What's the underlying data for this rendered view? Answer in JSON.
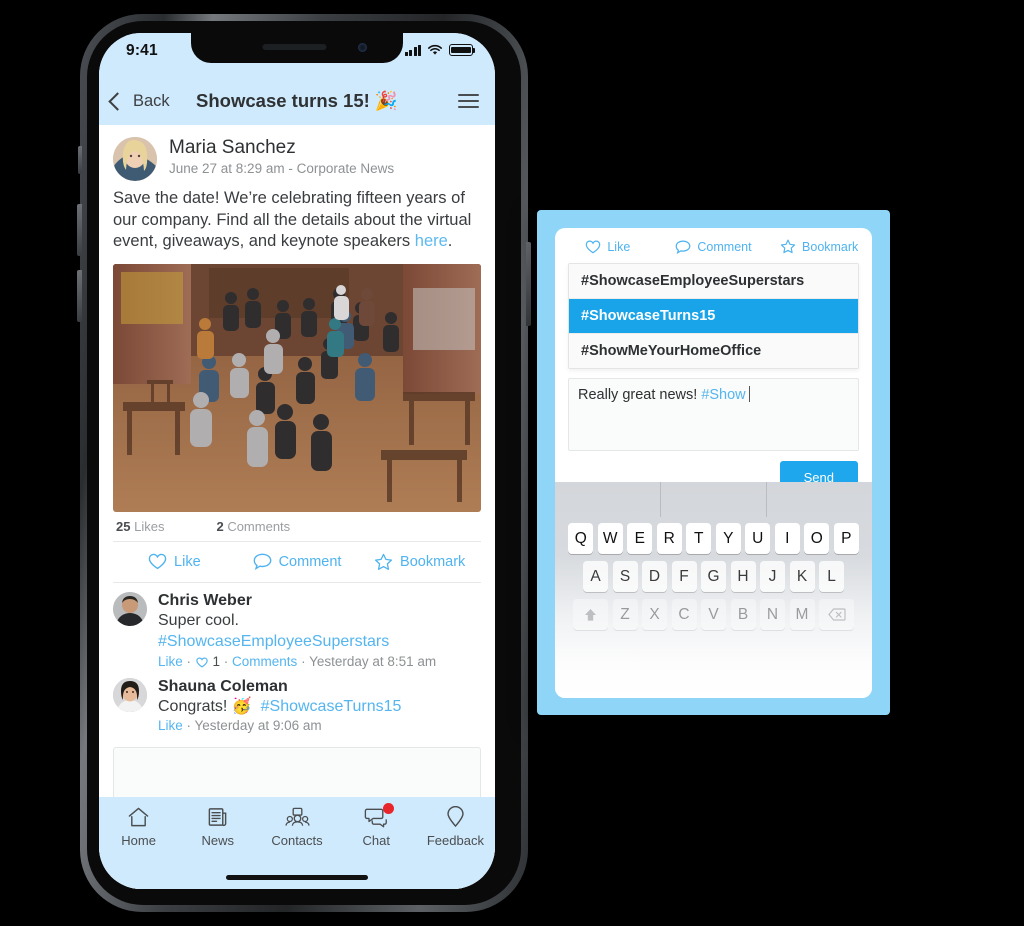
{
  "phone": {
    "status_bar": {
      "time": "9:41",
      "signal_icon": "cellular-signal-icon",
      "wifi_icon": "wifi-icon",
      "battery_icon": "battery-icon"
    },
    "nav": {
      "back_label": "Back",
      "title": "Showcase turns 15! 🎉",
      "menu_icon": "hamburger-menu-icon",
      "back_icon": "chevron-left-icon"
    },
    "post": {
      "author": "Maria Sanchez",
      "meta": "June 27 at 8:29 am - Corporate News",
      "body_part1": "Save the date! We’re celebrating fifteen years of our company. Find all the details about the virtual event, giveaways, and keynote speakers ",
      "body_link": "here",
      "body_part2": ".",
      "likes_count": "25",
      "likes_label": "Likes",
      "comments_count": "2",
      "comments_label": "Comments",
      "photo_alt": "group-photo-of-employees"
    },
    "actions": [
      {
        "label": "Like",
        "icon": "heart-outline-icon"
      },
      {
        "label": "Comment",
        "icon": "speech-bubble-icon"
      },
      {
        "label": "Bookmark",
        "icon": "star-outline-icon"
      }
    ],
    "comments": [
      {
        "name": "Chris Weber",
        "text": "Super cool.",
        "hashtag": "#ShowcaseEmployeeSuperstars",
        "like_label": "Like",
        "like_count": "1",
        "comments_label": "Comments",
        "time": "Yesterday at 8:51 am"
      },
      {
        "name": "Shauna Coleman",
        "text": "Congrats! 🥳",
        "hashtag": "#ShowcaseTurns15",
        "like_label": "Like",
        "time": "Yesterday at 9:06 am"
      }
    ],
    "reply_placeholder": "",
    "tabs": [
      {
        "label": "Home",
        "icon": "home-icon",
        "badge": false
      },
      {
        "label": "News",
        "icon": "newspaper-icon",
        "badge": false
      },
      {
        "label": "Contacts",
        "icon": "contacts-group-icon",
        "badge": false
      },
      {
        "label": "Chat",
        "icon": "chat-bubbles-icon",
        "badge": true
      },
      {
        "label": "Feedback",
        "icon": "location-pin-icon",
        "badge": false
      }
    ]
  },
  "panel": {
    "actions": [
      {
        "label": "Like",
        "icon": "heart-outline-icon"
      },
      {
        "label": "Comment",
        "icon": "speech-bubble-icon"
      },
      {
        "label": "Bookmark",
        "icon": "star-outline-icon"
      }
    ],
    "suggestions": [
      {
        "label": "#ShowcaseEmployeeSuperstars",
        "selected": false
      },
      {
        "label": "#ShowcaseTurns15",
        "selected": true
      },
      {
        "label": "#ShowMeYourHomeOffice",
        "selected": false
      }
    ],
    "compose": {
      "text": "Really great news!",
      "tag": "#Show"
    },
    "send_label": "Send",
    "keyboard": {
      "row1": [
        "Q",
        "W",
        "E",
        "R",
        "T",
        "Y",
        "U",
        "I",
        "O",
        "P"
      ],
      "row2": [
        "A",
        "S",
        "D",
        "F",
        "G",
        "H",
        "J",
        "K",
        "L"
      ],
      "row3": [
        "Z",
        "X",
        "C",
        "V",
        "B",
        "N",
        "M"
      ],
      "shift_icon": "shift-arrow-icon",
      "backspace_icon": "backspace-icon"
    }
  },
  "colors": {
    "header_blue": "#cfeafc",
    "accent_blue": "#1ea7ec",
    "link_blue": "#54b5ef",
    "panel_blue": "#8ed5f8",
    "badge_red": "#e8252a"
  }
}
